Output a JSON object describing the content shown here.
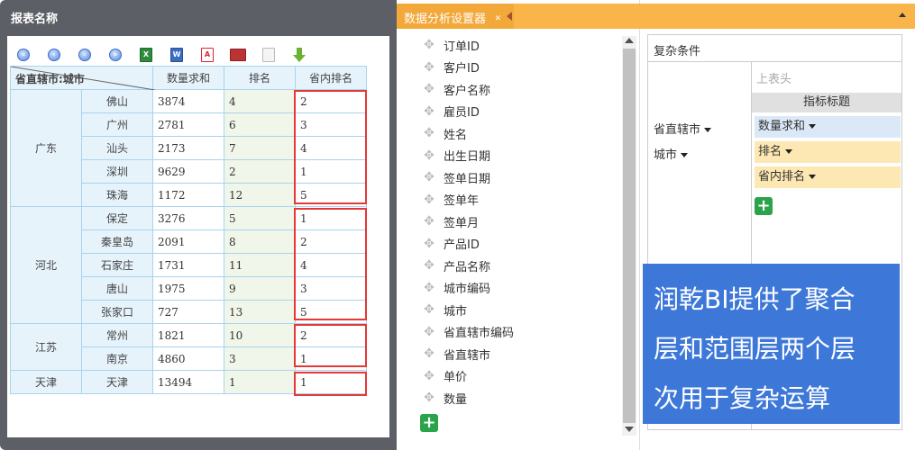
{
  "report": {
    "title": "报表名称",
    "toolbar": {
      "first": "◀◀",
      "prev": "◀",
      "next": "▶",
      "last": "▶▶"
    },
    "columns": {
      "corner_top": "省直辖市",
      "corner_label": "省直辖市:城市",
      "sum": "数量求和",
      "rank": "排名",
      "prov_rank": "省内排名"
    },
    "groups": [
      {
        "province": "广东",
        "rows": [
          {
            "city": "佛山",
            "sum": "3874",
            "rank": "4",
            "prov_rank": "2"
          },
          {
            "city": "广州",
            "sum": "2781",
            "rank": "6",
            "prov_rank": "3"
          },
          {
            "city": "汕头",
            "sum": "2173",
            "rank": "7",
            "prov_rank": "4"
          },
          {
            "city": "深圳",
            "sum": "9629",
            "rank": "2",
            "prov_rank": "1"
          },
          {
            "city": "珠海",
            "sum": "1172",
            "rank": "12",
            "prov_rank": "5"
          }
        ]
      },
      {
        "province": "河北",
        "rows": [
          {
            "city": "保定",
            "sum": "3276",
            "rank": "5",
            "prov_rank": "1"
          },
          {
            "city": "秦皇岛",
            "sum": "2091",
            "rank": "8",
            "prov_rank": "2"
          },
          {
            "city": "石家庄",
            "sum": "1731",
            "rank": "11",
            "prov_rank": "4"
          },
          {
            "city": "唐山",
            "sum": "1975",
            "rank": "9",
            "prov_rank": "3"
          },
          {
            "city": "张家口",
            "sum": "727",
            "rank": "13",
            "prov_rank": "5"
          }
        ]
      },
      {
        "province": "江苏",
        "rows": [
          {
            "city": "常州",
            "sum": "1821",
            "rank": "10",
            "prov_rank": "2"
          },
          {
            "city": "南京",
            "sum": "4860",
            "rank": "3",
            "prov_rank": "1"
          }
        ]
      },
      {
        "province": "天津",
        "rows": [
          {
            "city": "天津",
            "sum": "13494",
            "rank": "1",
            "prov_rank": "1"
          }
        ]
      }
    ]
  },
  "field_panel": {
    "tab_label": "数据分析设置器",
    "fields": [
      "订单ID",
      "客户ID",
      "客户名称",
      "雇员ID",
      "姓名",
      "出生日期",
      "签单日期",
      "签单年",
      "签单月",
      "产品ID",
      "产品名称",
      "城市编码",
      "城市",
      "省直辖市编码",
      "省直辖市",
      "单价",
      "数量"
    ],
    "add_label": "+"
  },
  "settings": {
    "title": "复杂条件",
    "upper_header": "上表头",
    "metric_title": "指标标题",
    "row_dims": [
      "省直辖市",
      "城市"
    ],
    "metrics": [
      "数量求和",
      "排名",
      "省内排名"
    ],
    "add_label": "+"
  },
  "caption": {
    "lines": [
      "润乾BI提供了聚合",
      "层和范围层两个层",
      "次用于复杂运算"
    ]
  },
  "colors": {
    "report_frame": "#5d5f66",
    "header_fill": "#e6f3fb",
    "grid_border": "#a9d3ee",
    "tab_orange": "#f3a83a",
    "bar_orange": "#f9b54a",
    "highlight_red": "#e53935",
    "add_green": "#2aa34a",
    "chip_blue": "#dbe8f7",
    "chip_yellow": "#fde7b2",
    "caption_blue": "#3d78d9"
  },
  "icons": {
    "toolbar": [
      "first-page-icon",
      "prev-page-icon",
      "next-page-icon",
      "last-page-icon",
      "excel-export-icon",
      "word-export-icon",
      "pdf-export-icon",
      "print-icon",
      "text-export-icon",
      "download-icon"
    ],
    "field": "move-icon"
  }
}
